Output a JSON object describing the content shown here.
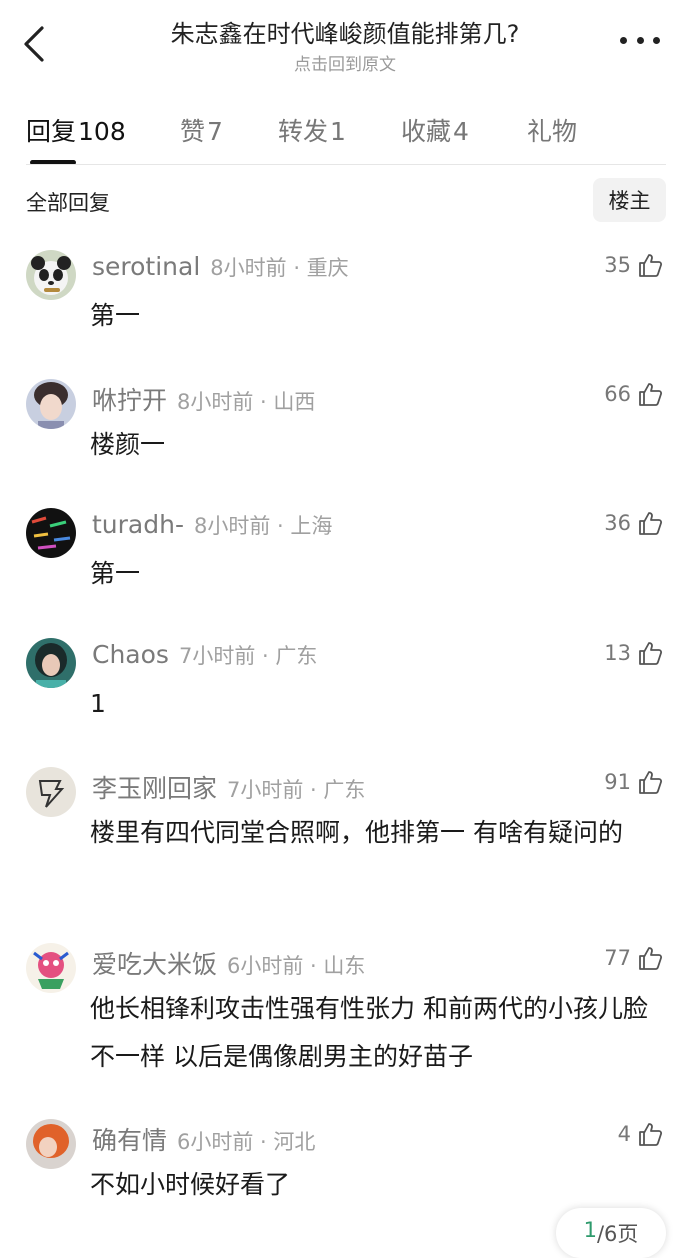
{
  "header": {
    "title": "朱志鑫在时代峰峻颜值能排第几?",
    "subtitle": "点击回到原文"
  },
  "tabs": [
    {
      "label": "回复",
      "count": "108"
    },
    {
      "label": "赞",
      "count": "7"
    },
    {
      "label": "转发",
      "count": "1"
    },
    {
      "label": "收藏",
      "count": "4"
    },
    {
      "label": "礼物",
      "count": ""
    }
  ],
  "filter": {
    "label": "全部回复",
    "owner_button": "楼主"
  },
  "comments": [
    {
      "user": "serotinal",
      "time": "8小时前 · 重庆",
      "likes": "35",
      "text": "第一"
    },
    {
      "user": "咻拧开",
      "time": "8小时前 · 山西",
      "likes": "66",
      "text": "楼颜一"
    },
    {
      "user": "turadh-",
      "time": "8小时前 · 上海",
      "likes": "36",
      "text": "第一"
    },
    {
      "user": "Chaos",
      "time": "7小时前 · 广东",
      "likes": "13",
      "text": "1"
    },
    {
      "user": "李玉刚回家",
      "time": "7小时前 · 广东",
      "likes": "91",
      "text": "楼里有四代同堂合照啊，他排第一 有啥有疑问的"
    },
    {
      "user": "爱吃大米饭",
      "time": "6小时前 · 山东",
      "likes": "77",
      "text": "他长相锋利攻击性强有性张力 和前两代的小孩儿脸不一样 以后是偶像剧男主的好苗子"
    },
    {
      "user": "确有情",
      "time": "6小时前 · 河北",
      "likes": "4",
      "text": "不如小时候好看了"
    }
  ],
  "pager": {
    "current": "1",
    "total": "/6页"
  }
}
